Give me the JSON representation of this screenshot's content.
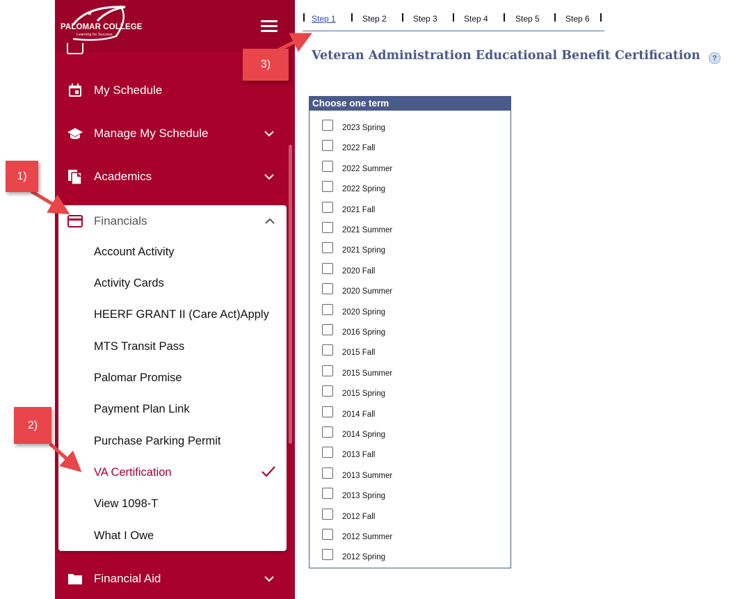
{
  "brand": {
    "name": "PALOMAR COLLEGE",
    "tagline": "Learning for Success"
  },
  "nav": [
    {
      "label": "My Schedule",
      "icon": "calendar-icon"
    },
    {
      "label": "Manage My Schedule",
      "icon": "graduation-cap-icon"
    },
    {
      "label": "Academics",
      "icon": "documents-icon"
    }
  ],
  "financials": {
    "label": "Financials",
    "icon": "credit-card-icon",
    "items": [
      "Account Activity",
      "Activity Cards",
      "HEERF GRANT II (Care Act)Apply",
      "MTS Transit Pass",
      "Palomar Promise",
      "Payment Plan Link",
      "Purchase Parking Permit",
      "VA Certification",
      "View 1098-T",
      "What I Owe"
    ],
    "active_item": "VA Certification"
  },
  "nav_bottom": {
    "label": "Financial Aid",
    "icon": "folder-icon"
  },
  "steps": [
    "Step 1",
    "Step 2",
    "Step 3",
    "Step 4",
    "Step 5",
    "Step 6"
  ],
  "page_title": "Veteran Administration Educational Benefit Certification",
  "help_label": "?",
  "terms": {
    "header": "Choose one term",
    "items": [
      "2023 Spring",
      "2022 Fall",
      "2022 Summer",
      "2022 Spring",
      "2021 Fall",
      "2021 Summer",
      "2021 Spring",
      "2020 Fall",
      "2020 Summer",
      "2020 Spring",
      "2016 Spring",
      "2015 Fall",
      "2015 Summer",
      "2015 Spring",
      "2014 Fall",
      "2014 Spring",
      "2013 Fall",
      "2013 Summer",
      "2013 Spring",
      "2012 Fall",
      "2012 Summer",
      "2012 Spring"
    ]
  },
  "annotations": [
    "1)",
    "2)",
    "3)"
  ],
  "colors": {
    "brand": "#a8012b",
    "header_blue": "#4a5a8a",
    "callout": "#e8464a"
  }
}
